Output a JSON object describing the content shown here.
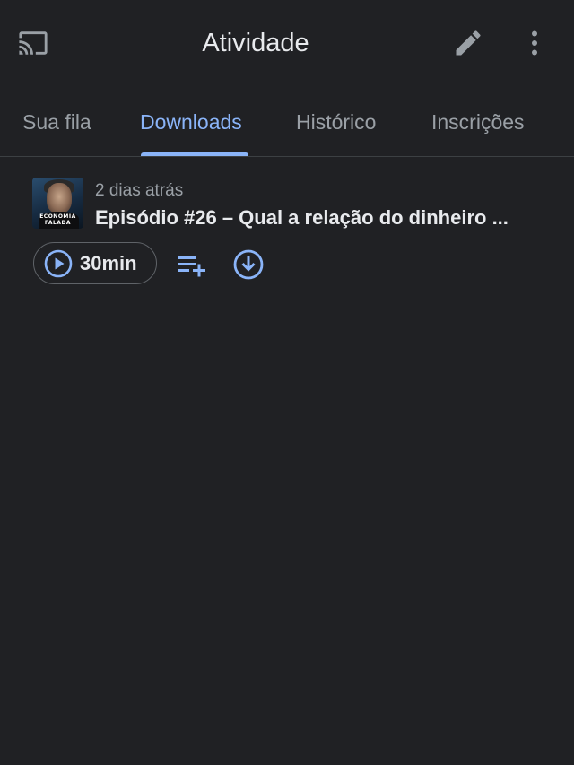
{
  "header": {
    "title": "Atividade",
    "icons": {
      "cast": "cast-icon",
      "edit": "edit-pencil-icon",
      "more": "more-vert-icon"
    }
  },
  "tabs": [
    {
      "label": "Sua fila",
      "active": false
    },
    {
      "label": "Downloads",
      "active": true
    },
    {
      "label": "Histórico",
      "active": false
    },
    {
      "label": "Inscrições",
      "active": false
    }
  ],
  "episodes": [
    {
      "date": "2 dias atrás",
      "title": "Episódio #26 –  Qual a relação do dinheiro ...",
      "duration": "30min",
      "artwork_text": "ECONOMIA FALADA",
      "actions": {
        "play": "play-circle-icon",
        "add_to_queue": "playlist-add-icon",
        "download": "download-circle-icon"
      }
    }
  ],
  "colors": {
    "background": "#202124",
    "accent": "#8ab4f8",
    "text_primary": "#e8eaed",
    "text_secondary": "#9aa0a6"
  }
}
